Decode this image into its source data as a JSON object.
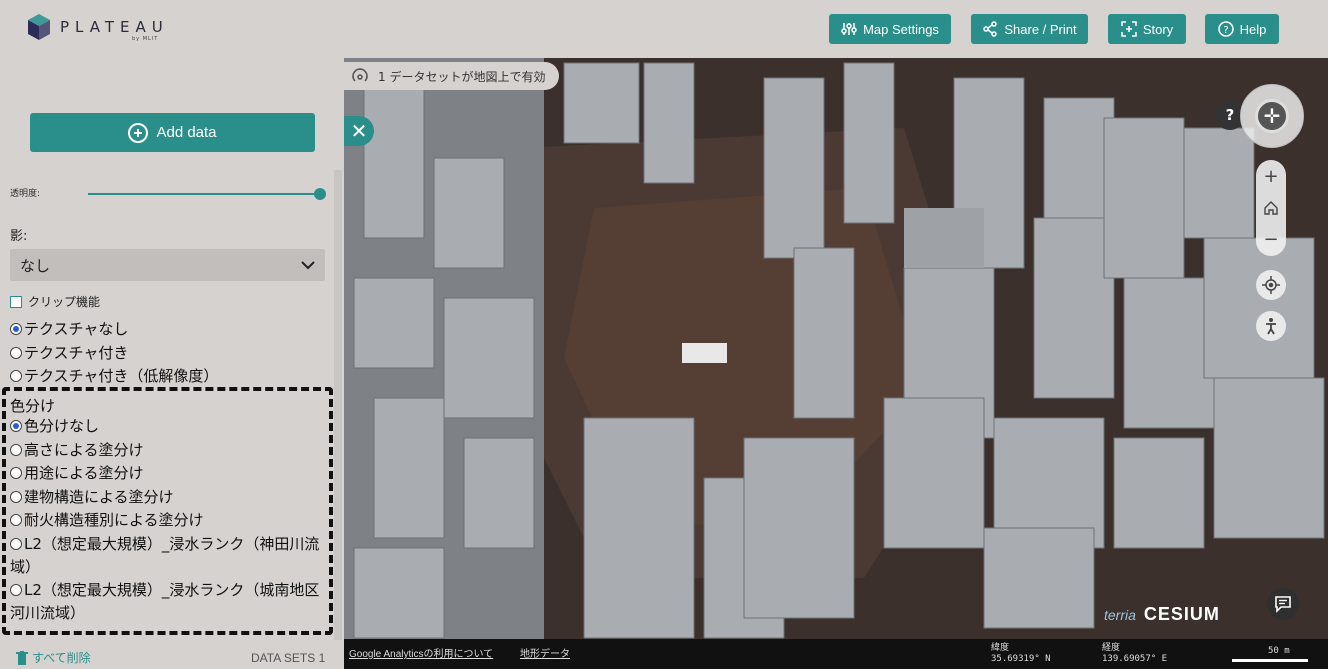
{
  "header": {
    "logo_text": "PLATEAU",
    "logo_sub": "by MLIT",
    "buttons": [
      {
        "label": "Map Settings",
        "icon": "sliders-icon"
      },
      {
        "label": "Share / Print",
        "icon": "share-icon"
      },
      {
        "label": "Story",
        "icon": "story-icon"
      },
      {
        "label": "Help",
        "icon": "help-icon"
      }
    ]
  },
  "sidebar": {
    "add_data_label": "Add data",
    "opacity_label": "透明度:",
    "opacity_value": 1.0,
    "shadow_label": "影:",
    "shadow_select_value": "なし",
    "clip_label": "クリップ機能",
    "texture_options": [
      {
        "label": "テクスチャなし",
        "checked": true
      },
      {
        "label": "テクスチャ付き",
        "checked": false
      },
      {
        "label": "テクスチャ付き（低解像度）",
        "checked": false
      }
    ],
    "color_title": "色分け",
    "color_options": [
      {
        "label": "色分けなし",
        "checked": true
      },
      {
        "label": "高さによる塗分け",
        "checked": false
      },
      {
        "label": "用途による塗分け",
        "checked": false
      },
      {
        "label": "建物構造による塗分け",
        "checked": false
      },
      {
        "label": "耐火構造種別による塗分け",
        "checked": false
      },
      {
        "label": "L2（想定最大規模）_浸水ランク（神田川流域）",
        "checked": false
      },
      {
        "label": "L2（想定最大規模）_浸水ランク（城南地区河川流域）",
        "checked": false
      }
    ],
    "remove_all_label": "すべて削除",
    "datasets_label": "DATA SETS 1"
  },
  "map": {
    "notice_text": "1 データセットが地図上で有効",
    "help_label": "?",
    "zoom_in": "+",
    "zoom_out": "−",
    "credits": {
      "terria": "terria",
      "cesium": "CESIUM"
    },
    "status": {
      "analytics_link": "Google Analyticsの利用について",
      "terrain_link": "地形データ",
      "lat_label": "緯度",
      "lat_value": "35.69319° N",
      "lon_label": "経度",
      "lon_value": "139.69057° E",
      "scale_label": "50 m"
    }
  },
  "colors": {
    "accent": "#2a8f8a",
    "panel": "#d6d2cf",
    "status_bar": "#111111"
  }
}
